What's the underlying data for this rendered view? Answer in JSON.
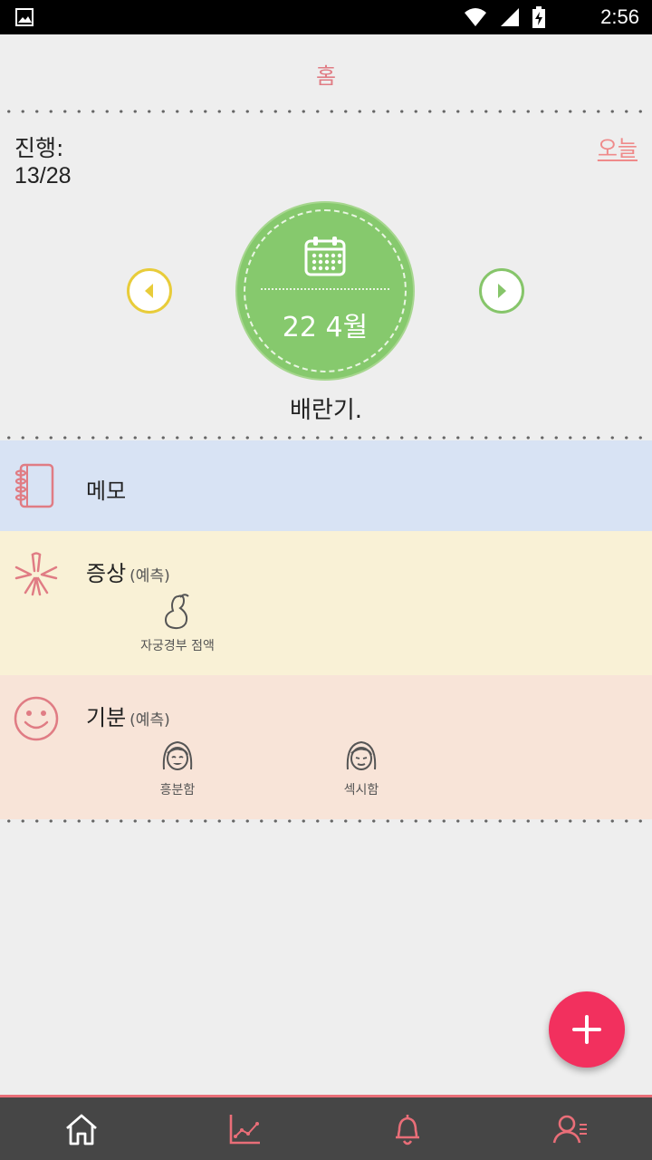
{
  "status_bar": {
    "time": "2:56",
    "icons": [
      "image-icon",
      "wifi-icon",
      "signal-icon",
      "battery-charging-icon"
    ]
  },
  "header": {
    "title": "홈"
  },
  "progress": {
    "label": "진행:",
    "value": "13/28"
  },
  "today_link": "오늘",
  "day_selector": {
    "date": "22 4월",
    "phase": "배란기.",
    "colors": {
      "circle": "#86c96d",
      "prev": "#e8cc3a",
      "next": "#86c56a"
    }
  },
  "sections": {
    "notes": {
      "title": "메모"
    },
    "symptoms": {
      "title": "증상",
      "predicted": "(예측)",
      "items": [
        {
          "label": "자궁경부 점액",
          "icon": "cervical-mucus-icon"
        }
      ]
    },
    "mood": {
      "title": "기분",
      "predicted": "(예측)",
      "items": [
        {
          "label": "흥분함",
          "icon": "excited-face-icon"
        },
        {
          "label": "섹시함",
          "icon": "sexy-face-icon"
        }
      ]
    }
  },
  "fab": {
    "icon": "plus-icon",
    "color": "#f2305e"
  },
  "bottom_nav": {
    "tabs": [
      "home-icon",
      "chart-icon",
      "bell-icon",
      "profile-icon"
    ],
    "accent": "#e96e78"
  }
}
